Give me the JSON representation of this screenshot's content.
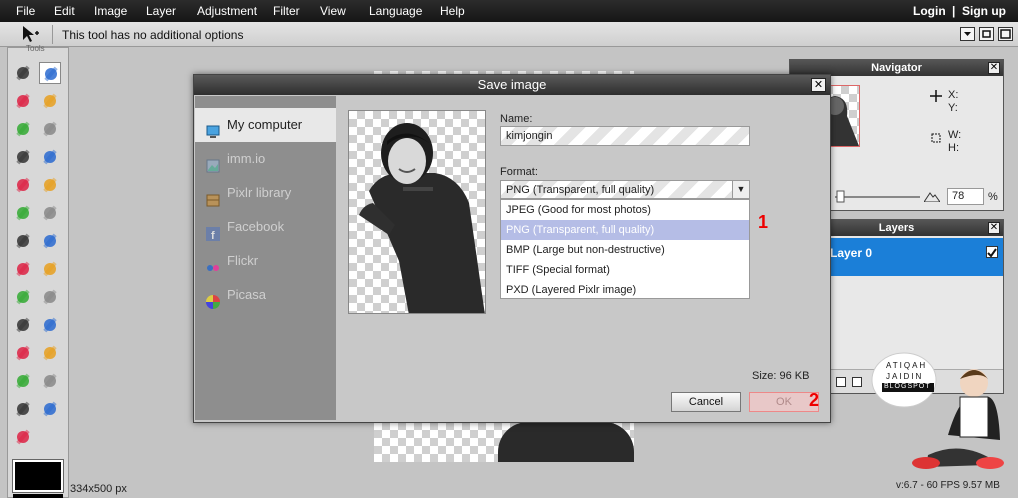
{
  "menubar": {
    "items": [
      "File",
      "Edit",
      "Image",
      "Layer",
      "Adjustment",
      "Filter",
      "View",
      "Language",
      "Help"
    ],
    "login": "Login",
    "separator": "|",
    "signup": "Sign up"
  },
  "optionsbar": {
    "message": "This tool has no additional options"
  },
  "tools": {
    "label": "Tools",
    "items": [
      "crop-icon",
      "move-icon",
      "marquee-icon",
      "lasso-icon",
      "wand-icon",
      "pencil-icon",
      "brush-icon",
      "eraser-icon",
      "bucket-icon",
      "gradient-icon",
      "stamp-icon",
      "colorreplace-icon",
      "drawing-icon",
      "blur-icon",
      "sharpen-icon",
      "smudge-icon",
      "sponge-icon",
      "dodge-icon",
      "burn-icon",
      "redeye-icon",
      "spotheal-icon",
      "bloat-icon",
      "pinch-icon",
      "picker-icon",
      "type-icon",
      "hand-icon",
      "zoom-icon"
    ]
  },
  "navigator": {
    "title": "Navigator",
    "x_label": "X:",
    "y_label": "Y:",
    "w_label": "W:",
    "h_label": "H:",
    "zoom_value": "78",
    "zoom_unit": "%"
  },
  "layers": {
    "title": "Layers",
    "layer_name": "Layer 0"
  },
  "status": {
    "dimensions": "334x500 px",
    "version": "v:6.7 - 60 FPS 9.57 MB"
  },
  "sticker": {
    "line1": "ATIQAH",
    "line2": "JAIDIN",
    "line3": "BLOGSPOT"
  },
  "dialog": {
    "title": "Save image",
    "close": "✕",
    "destinations": [
      "My computer",
      "imm.io",
      "Pixlr library",
      "Facebook",
      "Flickr",
      "Picasa"
    ],
    "name_label": "Name:",
    "name_value": "kimjongin",
    "format_label": "Format:",
    "format_selected": "PNG (Transparent, full quality)",
    "format_options": [
      "JPEG (Good for most photos)",
      "PNG (Transparent, full quality)",
      "BMP (Large but non-destructive)",
      "TIFF (Special format)",
      "PXD (Layered Pixlr image)"
    ],
    "size_text": "Size: 96 KB",
    "cancel_label": "Cancel",
    "ok_label": "OK",
    "annotation_1": "1",
    "annotation_2": "2"
  },
  "colors": {
    "highlight": "#b5bde6",
    "layer_selected": "#1b7fd8",
    "annotation": "#e00000"
  }
}
